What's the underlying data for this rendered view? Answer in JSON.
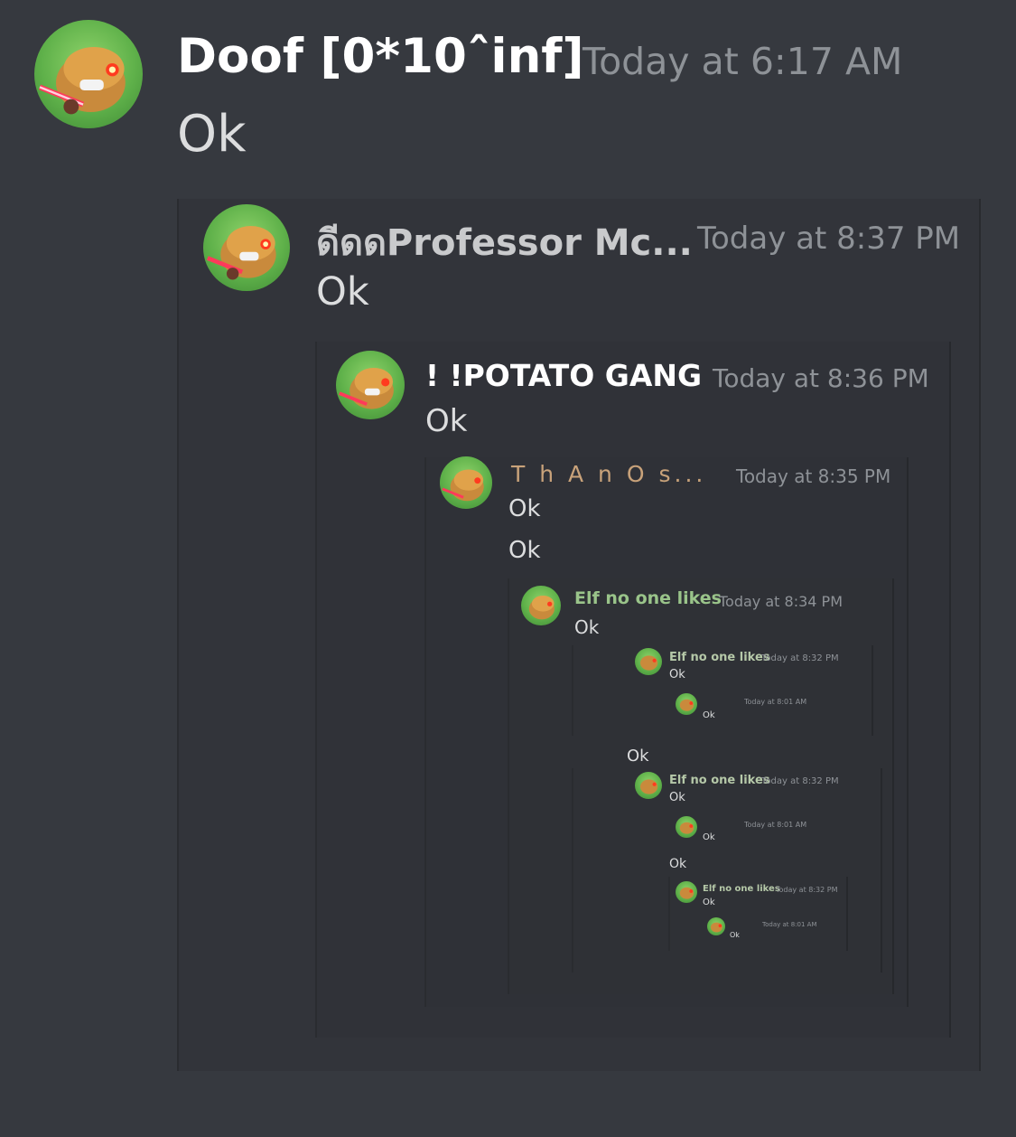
{
  "messages": {
    "m1": {
      "username": "Doof [0*10ˆinf]",
      "timestamp": "Today at 6:17 AM",
      "text": "Ok"
    },
    "m2": {
      "username": "ดีดดProfessor Mc...",
      "timestamp": "Today at 8:37 PM",
      "text": "Ok"
    },
    "m3": {
      "username": "! !POTATO GANG",
      "timestamp": "Today at 8:36 PM",
      "text": "Ok"
    },
    "m4": {
      "username": "T h A n O s...",
      "timestamp": "Today at 8:35 PM",
      "text": "Ok",
      "text2": "Ok",
      "username_color": "#c8a27a"
    },
    "m5": {
      "username": "Elf no one likes",
      "timestamp": "Today at 8:34 PM",
      "text": "Ok",
      "username_color": "#9ac48a"
    },
    "m6": {
      "username": "Elf no one likes",
      "timestamp": "Today at 8:32 PM",
      "text": "Ok"
    },
    "m7": {
      "username": "",
      "timestamp": "Today at 8:01 AM",
      "text": "Ok"
    },
    "m8_text": "Ok",
    "m9": {
      "username": "Elf no one likes",
      "timestamp": "Today at 8:32 PM",
      "text": "Ok"
    },
    "m10": {
      "username": "",
      "timestamp": "Today at 8:01 AM",
      "text": "Ok"
    },
    "m11_text": "Ok",
    "m12": {
      "username": "Elf no one likes",
      "timestamp": "Today at 8:32 PM",
      "text": "Ok"
    },
    "m13": {
      "username": "",
      "timestamp": "Today at 8:01 AM",
      "text": "Ok"
    }
  },
  "colors": {
    "background": "#36393f",
    "username": "#ffffff",
    "timestamp": "#8e9297",
    "message_text": "#dcddde",
    "hidden_username": "#6b2a2a"
  },
  "icons": {
    "avatar": "cartoon-potato-laser-eyes-icon"
  }
}
